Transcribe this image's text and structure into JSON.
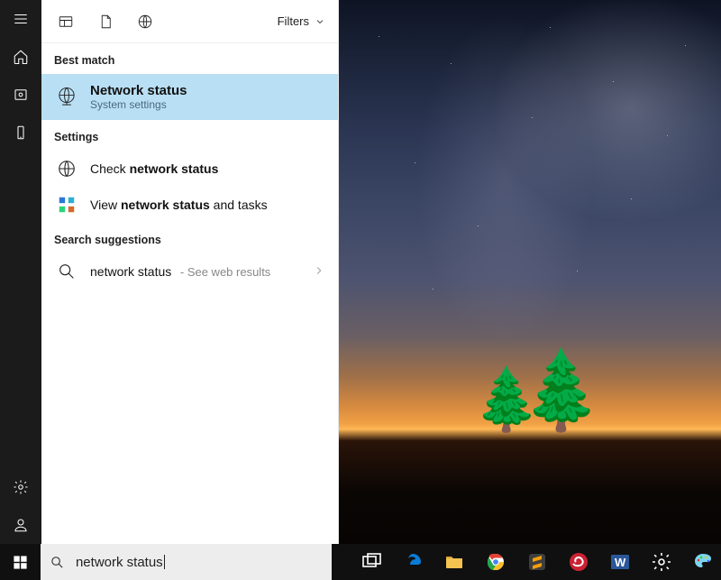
{
  "top": {
    "filters_label": "Filters"
  },
  "headers": {
    "best_match": "Best match",
    "settings": "Settings",
    "suggestions": "Search suggestions"
  },
  "best": {
    "title": "Network status",
    "subtitle": "System settings"
  },
  "settings_results": {
    "r0_pre": "Check ",
    "r0_bold": "network status",
    "r1_pre": "View ",
    "r1_bold": "network status",
    "r1_post": " and tasks"
  },
  "suggestion": {
    "query": "network status",
    "trail": " - See web results"
  },
  "search": {
    "query": "network status"
  },
  "top_icons": [
    "apps-panel-icon",
    "document-icon",
    "web-icon"
  ],
  "rail_icons": [
    "menu-icon",
    "home-icon",
    "photo-icon",
    "phone-icon",
    "settings-icon",
    "user-icon"
  ],
  "taskbar_icons": [
    "task-view-icon",
    "edge-icon",
    "file-explorer-icon",
    "chrome-icon",
    "sublime-icon",
    "swirl-app-icon",
    "word-icon",
    "settings-icon",
    "paint-icon"
  ]
}
